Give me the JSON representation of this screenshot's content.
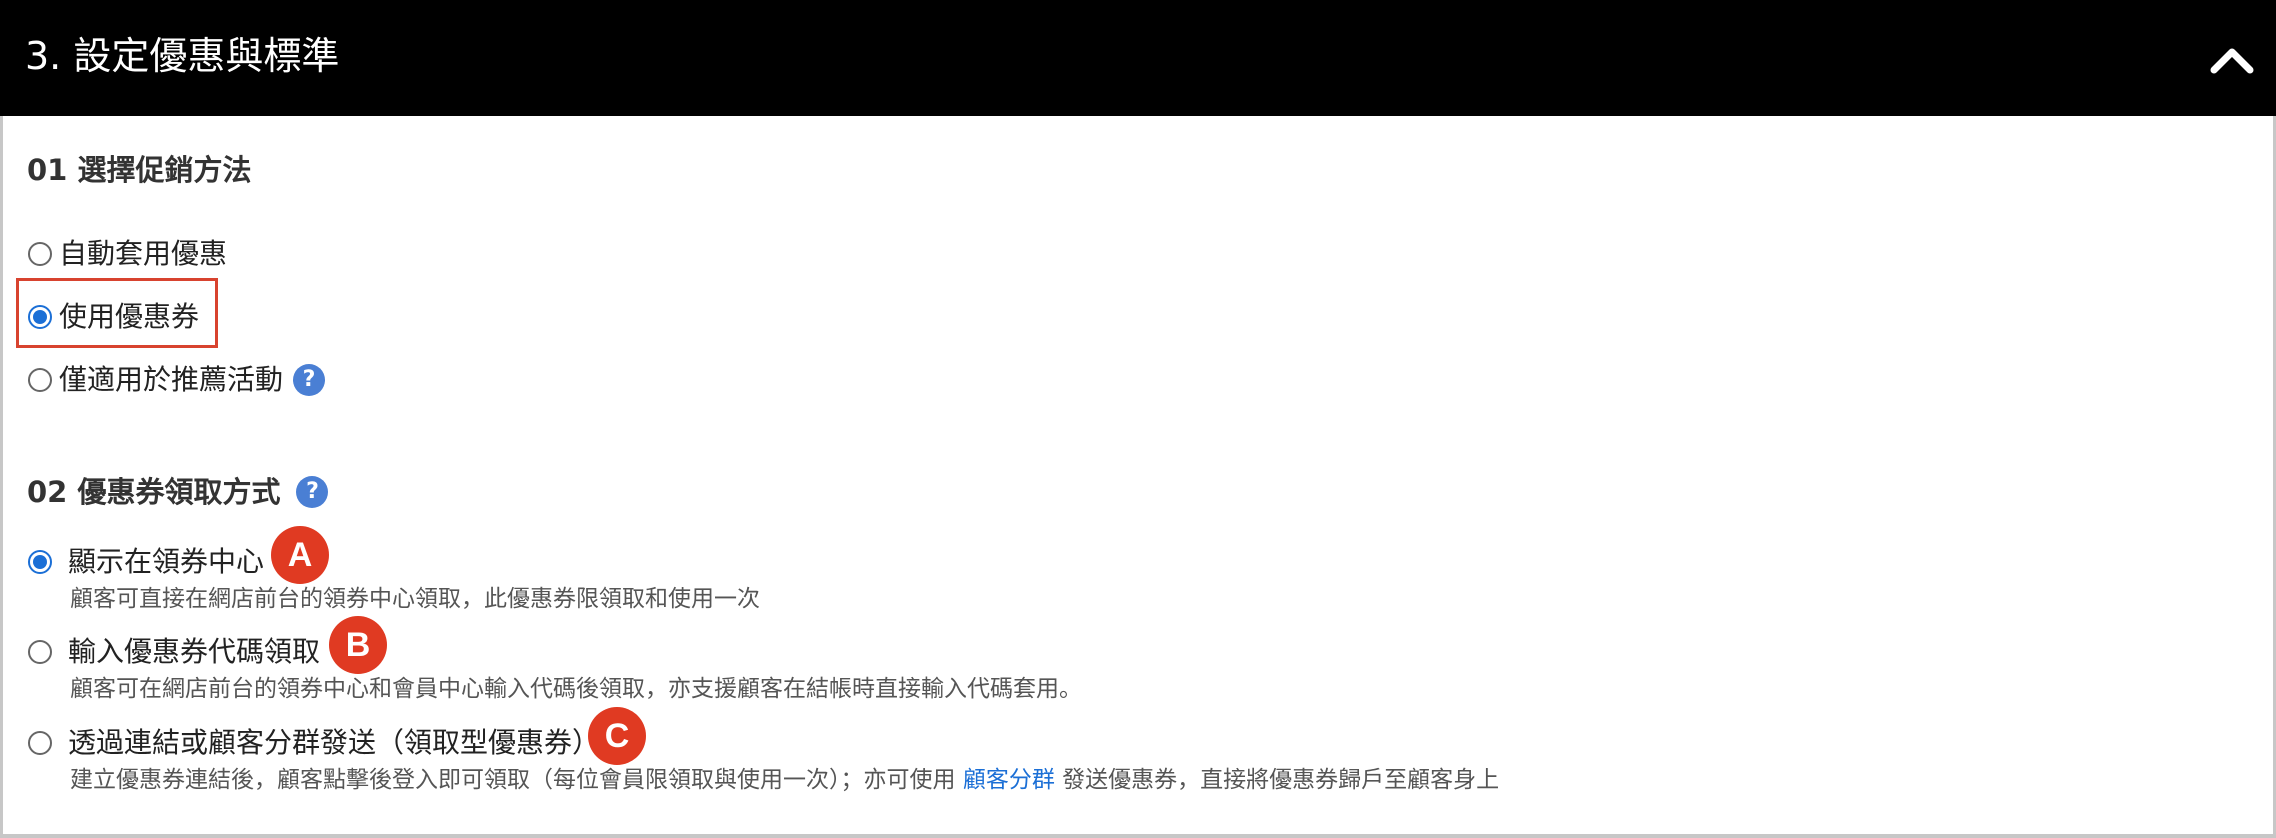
{
  "header": {
    "title": "3. 設定優惠與標準",
    "collapse_icon": "chevron-up-icon"
  },
  "section1": {
    "title": "01 選擇促銷方法",
    "options": [
      {
        "label": "自動套用優惠",
        "selected": false
      },
      {
        "label": "使用優惠券",
        "selected": true
      },
      {
        "label": "僅適用於推薦活動",
        "selected": false
      }
    ],
    "help_glyph": "?"
  },
  "section2": {
    "title": "02 優惠券領取方式",
    "help_glyph": "?",
    "options": [
      {
        "label": "顯示在領券中心",
        "selected": true,
        "marker": "A",
        "description": "顧客可直接在網店前台的領券中心領取，此優惠券限領取和使用一次"
      },
      {
        "label": "輸入優惠券代碼領取",
        "selected": false,
        "marker": "B",
        "description": "顧客可在網店前台的領券中心和會員中心輸入代碼後領取，亦支援顧客在結帳時直接輸入代碼套用。"
      },
      {
        "label": "透過連結或顧客分群發送（領取型優惠券）",
        "selected": false,
        "marker": "C",
        "description_before": "建立優惠券連結後，顧客點擊後登入即可領取（每位會員限領取與使用一次）；亦可使用",
        "description_link": "顧客分群",
        "description_after": "發送優惠券，直接將優惠券歸戶至顧客身上"
      }
    ]
  },
  "colors": {
    "header_bg": "#000000",
    "accent": "#1b6fd6",
    "highlight": "#d8432f",
    "marker": "#e03a22"
  }
}
